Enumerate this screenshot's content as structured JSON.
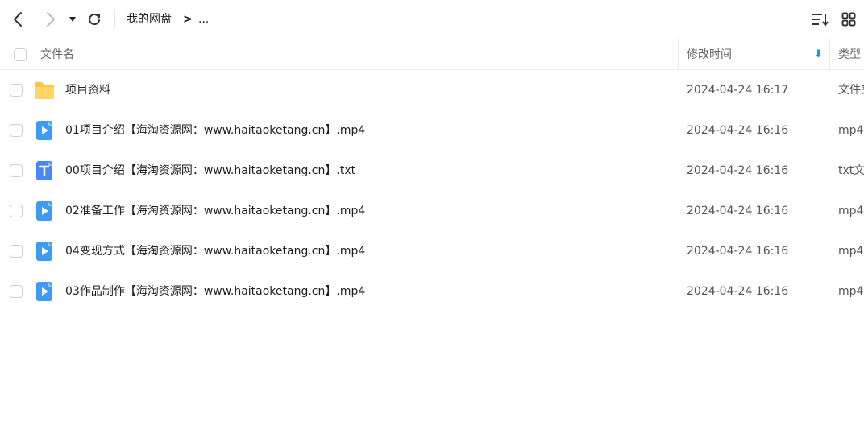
{
  "toolbar": {
    "back_icon": "chevron-left-icon",
    "forward_icon": "chevron-right-icon",
    "dropdown_icon": "triangle-down-icon",
    "refresh_icon": "refresh-icon",
    "breadcrumb_root": "我的网盘",
    "breadcrumb_sep": ">",
    "breadcrumb_more": "...",
    "sort_icon": "sort-list-icon",
    "view_icon": "grid-view-icon"
  },
  "header": {
    "name": "文件名",
    "modified": "修改时间",
    "type": "类型",
    "sort_indicator": "⬇"
  },
  "colors": {
    "folder": "#FFC53D",
    "video": "#3D9BF5",
    "text_file": "#4A86F7",
    "sort_arrow": "#1890ff"
  },
  "files": [
    {
      "icon": "folder-icon",
      "name": "项目资料",
      "modified": "2024-04-24 16:17",
      "type": "文件夹"
    },
    {
      "icon": "video-file-icon",
      "name": "01项目介绍【海淘资源网：www.haitaoketang.cn】.mp4",
      "modified": "2024-04-24 16:16",
      "type": "mp4"
    },
    {
      "icon": "text-file-icon",
      "name": "00项目介绍【海淘资源网：www.haitaoketang.cn】.txt",
      "modified": "2024-04-24 16:16",
      "type": "txt文件"
    },
    {
      "icon": "video-file-icon",
      "name": "02准备工作【海淘资源网：www.haitaoketang.cn】.mp4",
      "modified": "2024-04-24 16:16",
      "type": "mp4"
    },
    {
      "icon": "video-file-icon",
      "name": "04变现方式【海淘资源网：www.haitaoketang.cn】.mp4",
      "modified": "2024-04-24 16:16",
      "type": "mp4"
    },
    {
      "icon": "video-file-icon",
      "name": "03作品制作【海淘资源网：www.haitaoketang.cn】.mp4",
      "modified": "2024-04-24 16:16",
      "type": "mp4"
    }
  ]
}
